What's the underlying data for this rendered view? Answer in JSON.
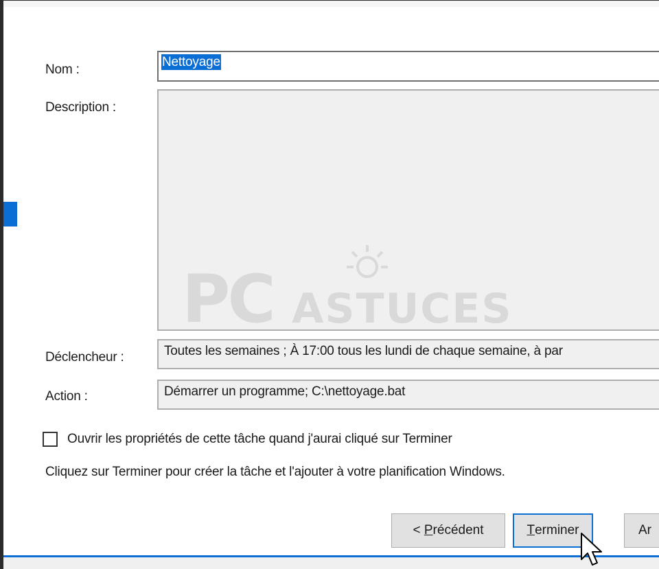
{
  "form": {
    "name_label": "Nom :",
    "name_value": "Nettoyage",
    "description_label": "Description :",
    "description_value": "",
    "trigger_label": "Déclencheur :",
    "trigger_value": "Toutes les semaines ; À 17:00 tous les lundi de chaque semaine, à par",
    "action_label": "Action :",
    "action_value": "Démarrer un programme; C:\\nettoyage.bat"
  },
  "watermark": {
    "part1": "PC",
    "part2": "ASTUCES"
  },
  "options": {
    "open_properties_label": "Ouvrir les propriétés de cette tâche quand j'aurai cliqué sur Terminer",
    "open_properties_checked": false,
    "info_text": "Cliquez sur Terminer pour créer la tâche et l'ajouter à votre planification Windows."
  },
  "buttons": {
    "prev_mnemonic": "P",
    "prev_rest": "récédent",
    "prev_prefix": "< ",
    "finish_mnemonic": "T",
    "finish_rest": "erminer",
    "cancel_partial": "Ar"
  },
  "colors": {
    "accent": "#0a6ed4",
    "field_bg": "#f0f0f0"
  },
  "icons": {
    "cursor": "arrow-cursor-icon",
    "sun": "sun-logo-icon"
  }
}
